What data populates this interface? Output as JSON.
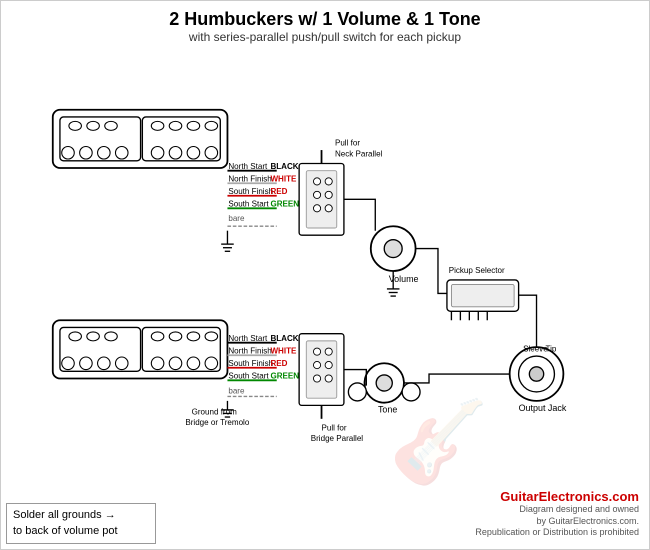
{
  "header": {
    "title": "2 Humbuckers w/ 1 Volume & 1 Tone",
    "subtitle": "with series-parallel push/pull switch for each pickup"
  },
  "labels": {
    "north_start": "North Start",
    "north_finish": "North Finish",
    "south_finish": "South Finish",
    "south_start": "South Start",
    "bare": "bare",
    "black": "BLACK",
    "white": "WHITE",
    "red": "RED",
    "green": "GREEN",
    "volume": "Volume",
    "tone": "Tone",
    "pickup_selector": "Pickup Selector",
    "output_jack": "Output Jack",
    "sleeve": "Sleeve",
    "tip": "Tip",
    "pull_neck": "Pull for\nNeck Parallel",
    "pull_bridge": "Pull for\nBridge Parallel",
    "ground_note": "Ground from\nBridge or Tremolo",
    "bottom_note_line1": "Solder all grounds",
    "bottom_note_arrow": "→",
    "bottom_note_line2": "to back of volume pot",
    "copyright": "GuitarElectronics.com",
    "copyright_line1": "Diagram designed and owned",
    "copyright_line2": "by GuitarElectronics.com.",
    "copyright_line3": "Republication or Distribution is prohibited"
  },
  "colors": {
    "black_wire": "#000000",
    "white_wire": "#ffffff",
    "red_wire": "#cc0000",
    "green_wire": "#008800",
    "accent": "#cc0000"
  }
}
